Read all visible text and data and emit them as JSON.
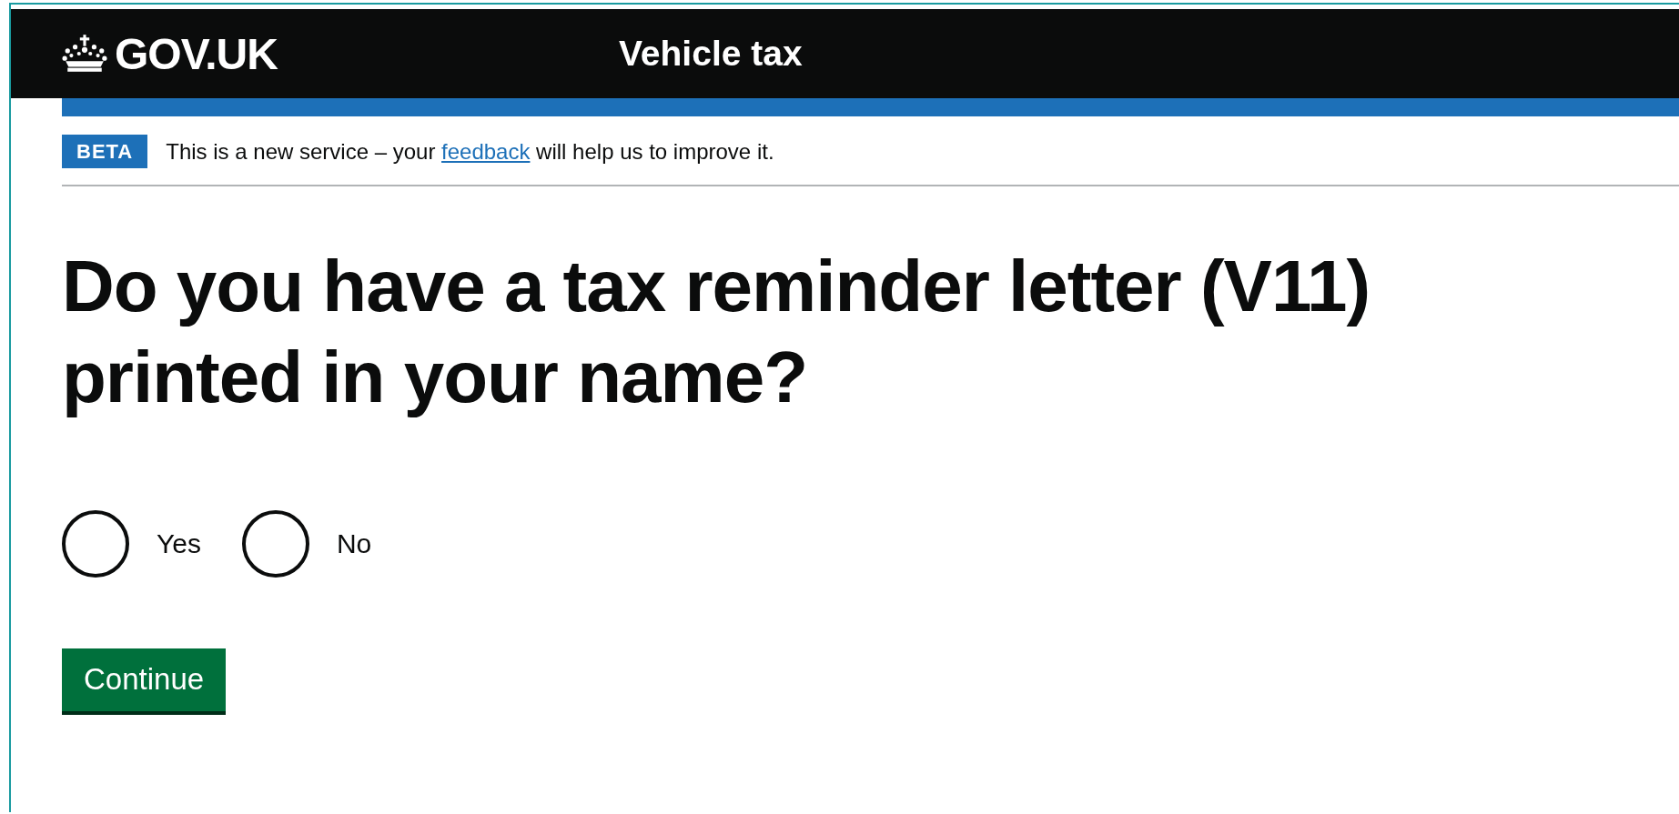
{
  "header": {
    "logo": "GOV.UK",
    "service_name": "Vehicle tax"
  },
  "phase_banner": {
    "tag": "BETA",
    "text_before": "This is a new service – your",
    "link": "feedback",
    "text_after": "will help us to improve it."
  },
  "question": {
    "title": "Do you have a tax reminder letter (V11) printed in your name?"
  },
  "options": [
    {
      "label": "Yes",
      "selected": false
    },
    {
      "label": "No",
      "selected": false
    }
  ],
  "buttons": [
    "Continue"
  ]
}
